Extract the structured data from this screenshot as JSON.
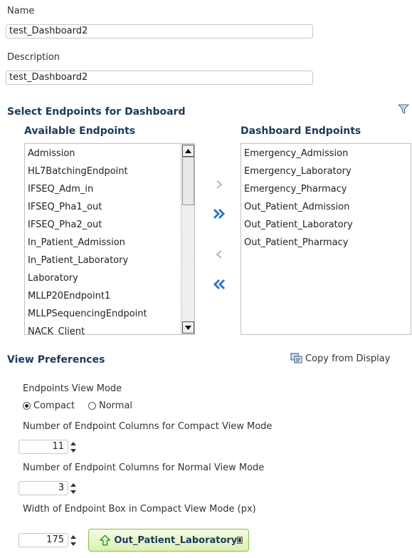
{
  "form": {
    "name_label": "Name",
    "name_value": "test_Dashboard2",
    "description_label": "Description",
    "description_value": "test_Dashboard2"
  },
  "endpoints": {
    "section_title": "Select Endpoints for Dashboard",
    "available_title": "Available Endpoints",
    "dashboard_title": "Dashboard Endpoints",
    "available": [
      "Admission",
      "HL7BatchingEndpoint",
      "IFSEQ_Adm_in",
      "IFSEQ_Pha1_out",
      "IFSEQ_Pha2_out",
      "In_Patient_Admission",
      "In_Patient_Laboratory",
      "Laboratory",
      "MLLP20Endpoint1",
      "MLLPSequencingEndpoint",
      "NACK_Client"
    ],
    "selected": [
      "Emergency_Admission",
      "Emergency_Laboratory",
      "Emergency_Pharmacy",
      "Out_Patient_Admission",
      "Out_Patient_Laboratory",
      "Out_Patient_Pharmacy"
    ],
    "icons": {
      "filter": "funnel-icon",
      "move": "chevron-right-icon",
      "move_all": "double-chevron-right-icon",
      "remove": "chevron-left-icon",
      "remove_all": "double-chevron-left-icon"
    }
  },
  "view_preferences": {
    "title": "View Preferences",
    "copy_label": "Copy from Display",
    "mode_label": "Endpoints View Mode",
    "mode_options": [
      "Compact",
      "Normal"
    ],
    "mode_selected": "Compact",
    "compact_columns_label": "Number of Endpoint Columns for Compact View Mode",
    "compact_columns_value": "11",
    "normal_columns_label": "Number of Endpoint Columns for Normal View Mode",
    "normal_columns_value": "3",
    "box_width_label": "Width of Endpoint Box in Compact View Mode (px)",
    "box_width_value": "175",
    "preview_endpoint": "Out_Patient_Laboratory"
  },
  "colors": {
    "section_title": "#1c3a5a",
    "shuttle_enabled": "#2f78c4",
    "shuttle_disabled": "#b5b5b5",
    "preview_border": "#8cbf3f",
    "preview_arrow": "#3a9a2a"
  }
}
